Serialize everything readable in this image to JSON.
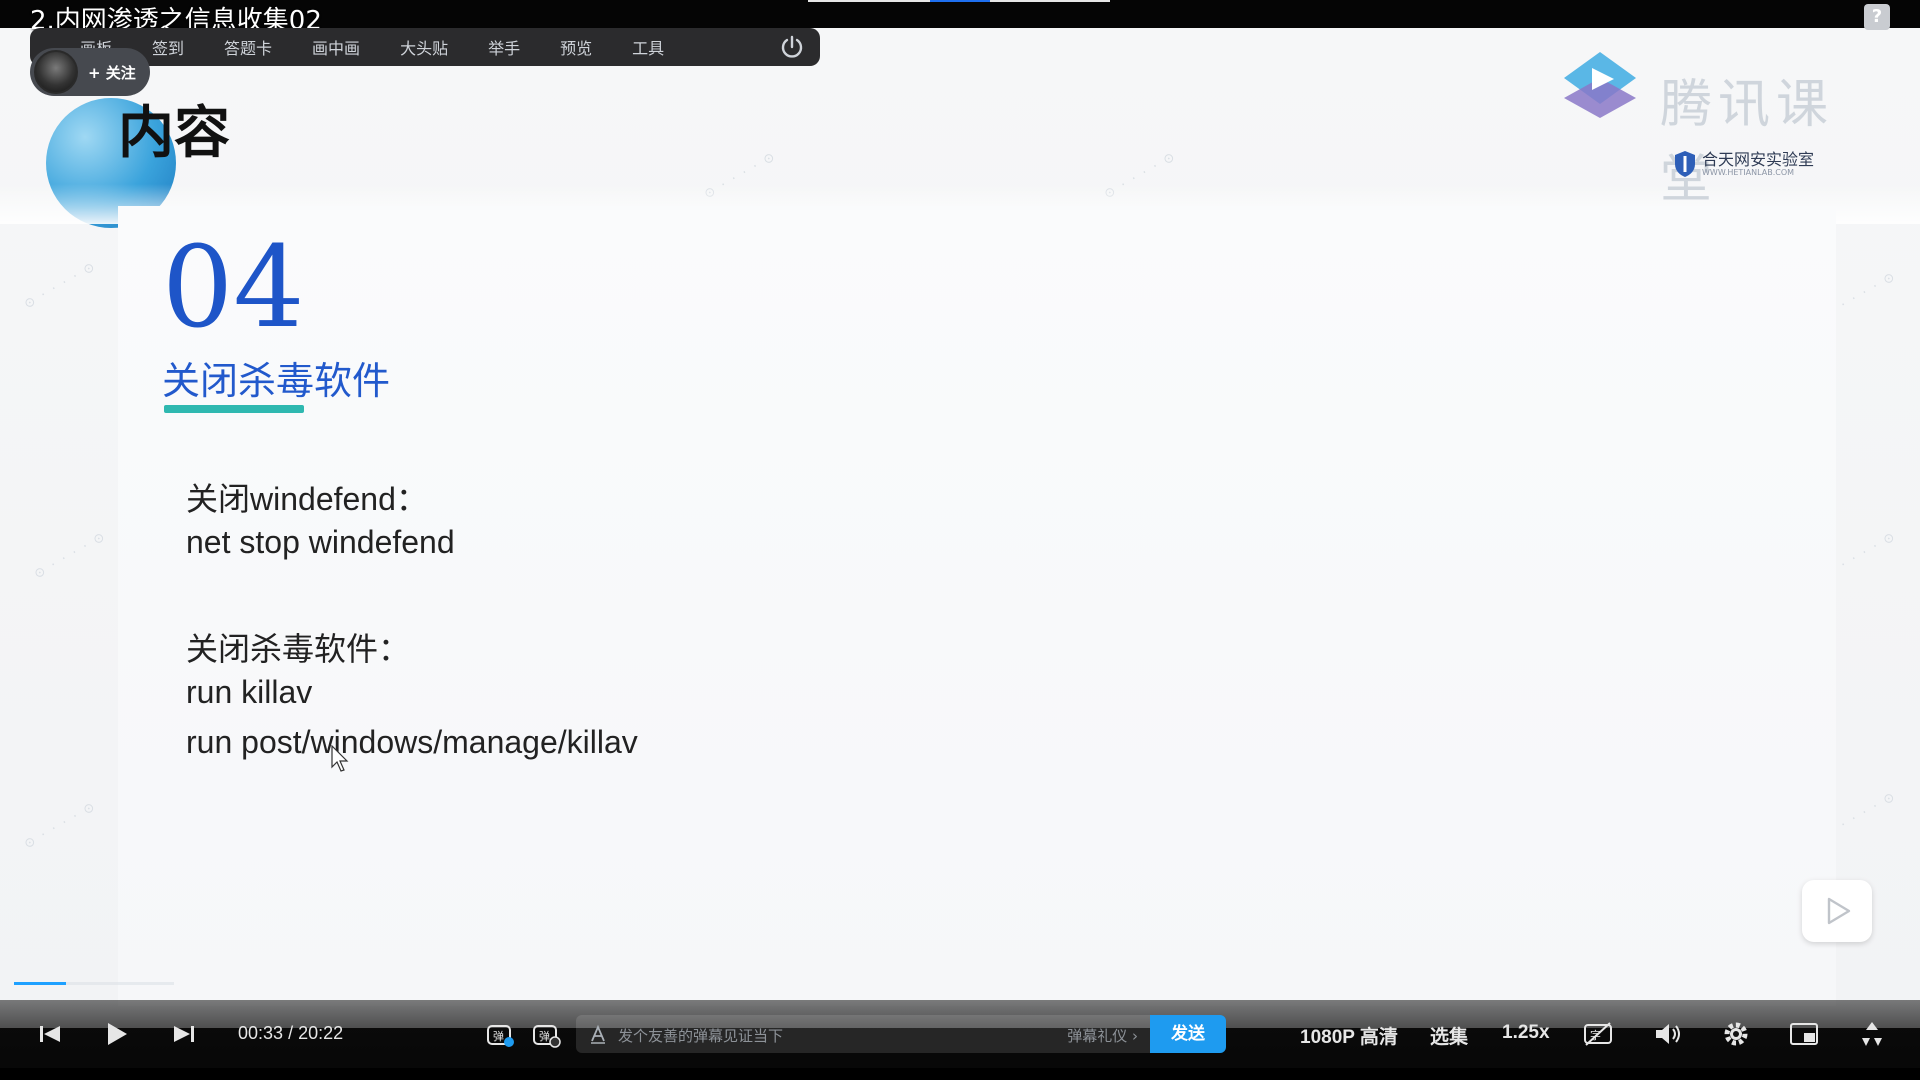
{
  "video": {
    "title": "2.内网渗透之信息收集02"
  },
  "toolbar": {
    "items": [
      "画板",
      "签到",
      "答题卡",
      "画中画",
      "大头贴",
      "举手",
      "预览",
      "工具"
    ]
  },
  "author": {
    "follow_label": "+ 关注"
  },
  "slide": {
    "header": "内容",
    "section_number": "04",
    "section_title": "关闭杀毒软件",
    "lines": [
      "关闭windefend：",
      "net stop windefend",
      "关闭杀毒软件：",
      "run killav",
      "run post/windows/manage/killav"
    ]
  },
  "branding": {
    "logo_text": "腾讯课堂",
    "sub_name": "合天网安实验室",
    "sub_url": "WWW.HETIANLAB.COM"
  },
  "player": {
    "time_current": "00:33",
    "time_separator": "/",
    "time_total": "20:22",
    "danmaku_placeholder": "发个友善的弹幕见证当下",
    "danmaku_gift": "弹幕礼仪 ›",
    "send_label": "发送",
    "quality": "1080P 高清",
    "episodes": "选集",
    "speed": "1.25x",
    "progress_fraction": 0.027
  },
  "colors": {
    "accent": "#1e9bf0",
    "section_blue": "#1e55c8",
    "underline_teal": "#2fb8b0"
  },
  "icons": [
    "prev-icon",
    "play-icon",
    "next-icon",
    "danmaku-toggle-icon",
    "danmaku-settings-icon",
    "text-icon",
    "subtitle-off-icon",
    "volume-icon",
    "settings-icon",
    "pip-icon",
    "fullscreen-icon",
    "power-icon",
    "help-icon"
  ]
}
